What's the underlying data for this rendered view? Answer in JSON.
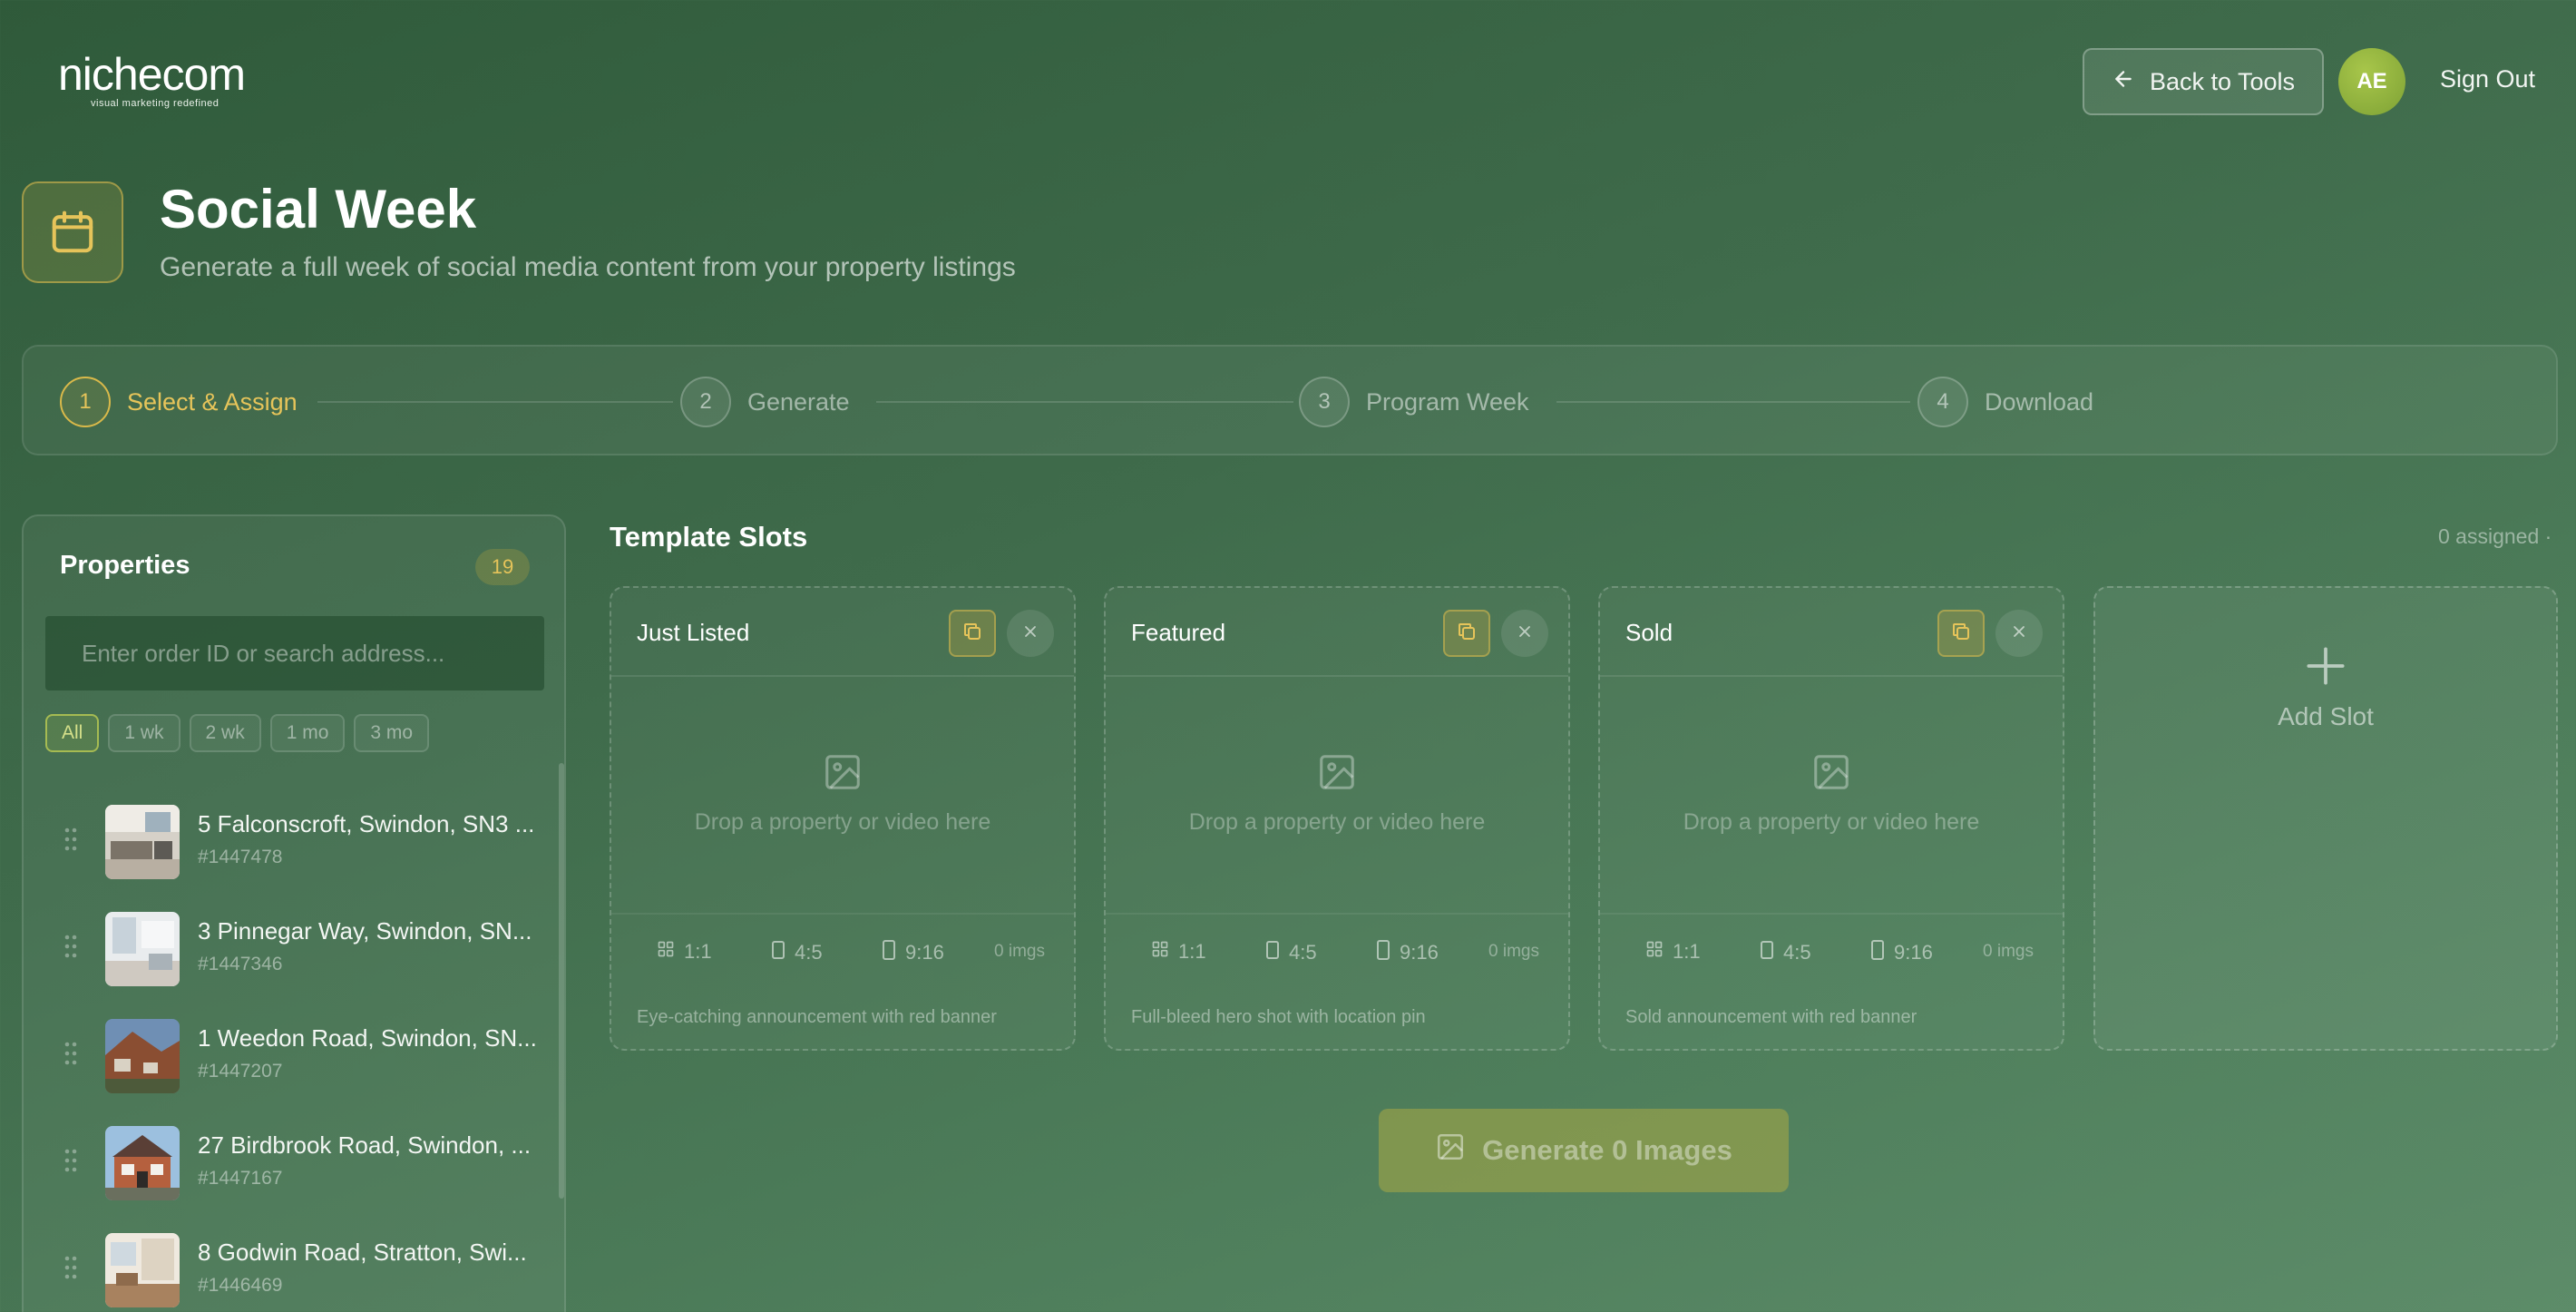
{
  "brand": {
    "logo_text": "nichecom",
    "tagline": "visual marketing redefined"
  },
  "header": {
    "back_label": "Back to Tools",
    "avatar_initials": "AE",
    "sign_out_label": "Sign Out"
  },
  "page": {
    "title": "Social Week",
    "subtitle": "Generate a full week of social media content from your property listings",
    "icon": "calendar-icon"
  },
  "steps": [
    {
      "num": "1",
      "label": "Select & Assign",
      "active": true
    },
    {
      "num": "2",
      "label": "Generate",
      "active": false
    },
    {
      "num": "3",
      "label": "Program Week",
      "active": false
    },
    {
      "num": "4",
      "label": "Download",
      "active": false
    }
  ],
  "properties": {
    "title": "Properties",
    "count": "19",
    "search_placeholder": "Enter order ID or search address...",
    "filters": [
      "All",
      "1 wk",
      "2 wk",
      "1 mo",
      "3 mo"
    ],
    "selected_filter": "All",
    "items": [
      {
        "address": "5 Falconscroft, Swindon, SN3 ...",
        "id": "#1447478"
      },
      {
        "address": "3 Pinnegar Way, Swindon, SN...",
        "id": "#1447346"
      },
      {
        "address": "1 Weedon Road, Swindon, SN...",
        "id": "#1447207"
      },
      {
        "address": "27 Birdbrook Road, Swindon, ...",
        "id": "#1447167"
      },
      {
        "address": "8 Godwin Road, Stratton, Swi...",
        "id": "#1446469"
      }
    ]
  },
  "slots": {
    "title": "Template Slots",
    "assigned": "0 assigned ·",
    "drop_text": "Drop a property or video here",
    "formats": [
      "1:1",
      "4:5",
      "9:16"
    ],
    "images_count": "0 imgs",
    "items": [
      {
        "name": "Just Listed",
        "desc": "Eye-catching announcement with red banner"
      },
      {
        "name": "Featured",
        "desc": "Full-bleed hero shot with location pin"
      },
      {
        "name": "Sold",
        "desc": "Sold announcement with red banner"
      }
    ],
    "add_label": "Add Slot"
  },
  "generate": {
    "label": "Generate 0 Images"
  },
  "colors": {
    "accent_gold": "#e6c45a",
    "avatar_green": "#8fb33e",
    "bg_dark": "#2f5a3a",
    "bg_light": "#5d8c69"
  }
}
